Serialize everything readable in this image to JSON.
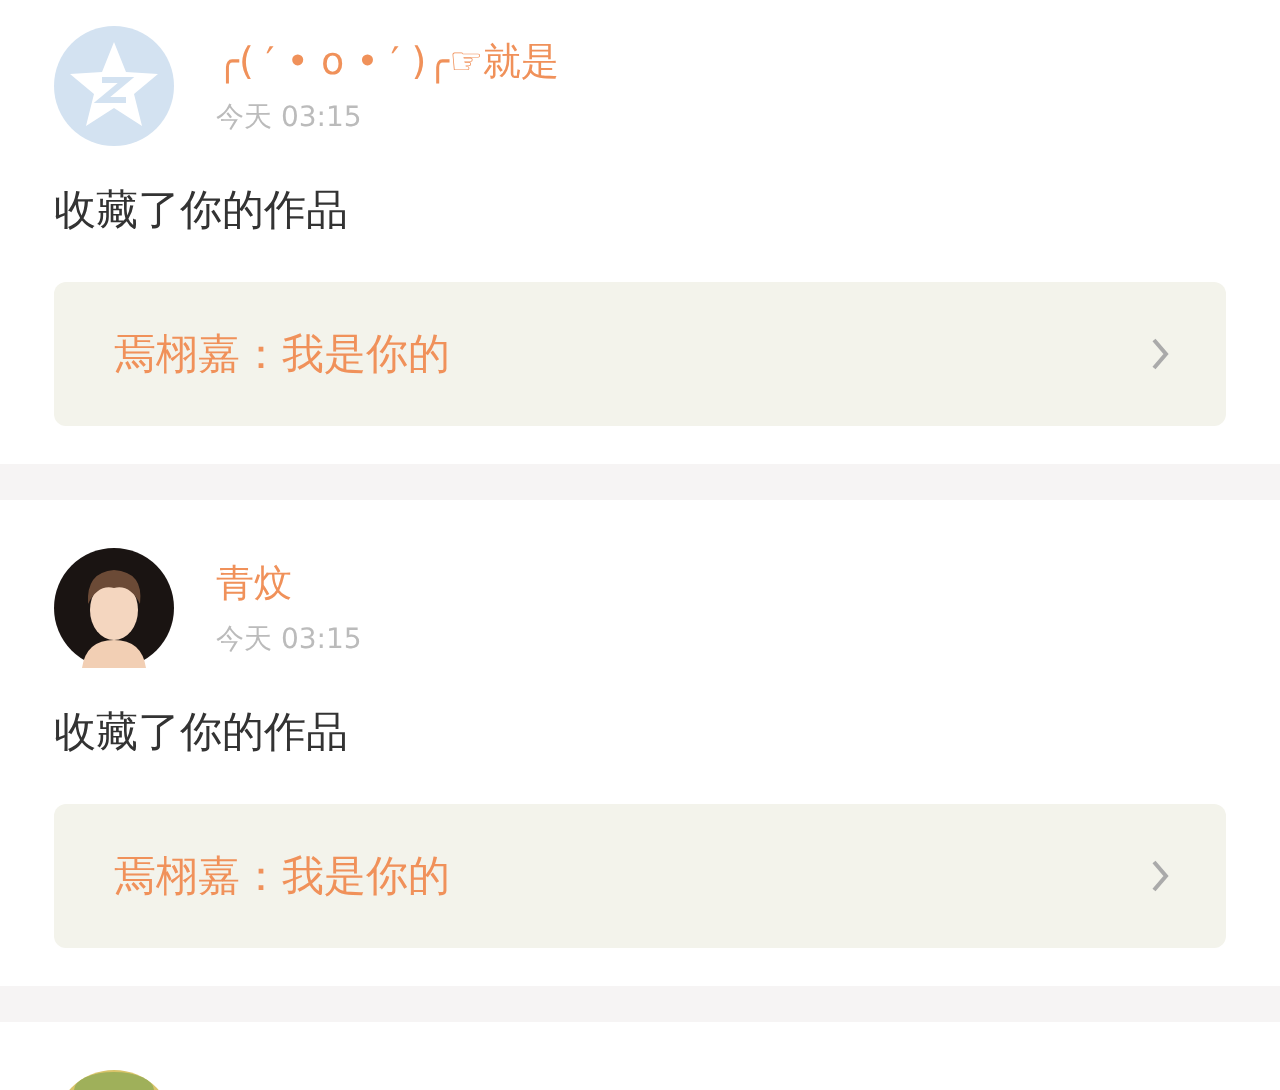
{
  "notifications": [
    {
      "avatar": {
        "kind": "star"
      },
      "name": "╭( ′ • o • ′ )╭☞就是",
      "time": "今天 03:15",
      "action": "收藏了你的作品",
      "quote": "焉栩嘉：我是你的"
    },
    {
      "avatar": {
        "kind": "person"
      },
      "name": "青炆",
      "time": "今天 03:15",
      "action": "收藏了你的作品",
      "quote": "焉栩嘉：我是你的"
    },
    {
      "avatar": {
        "kind": "picture"
      }
    }
  ]
}
